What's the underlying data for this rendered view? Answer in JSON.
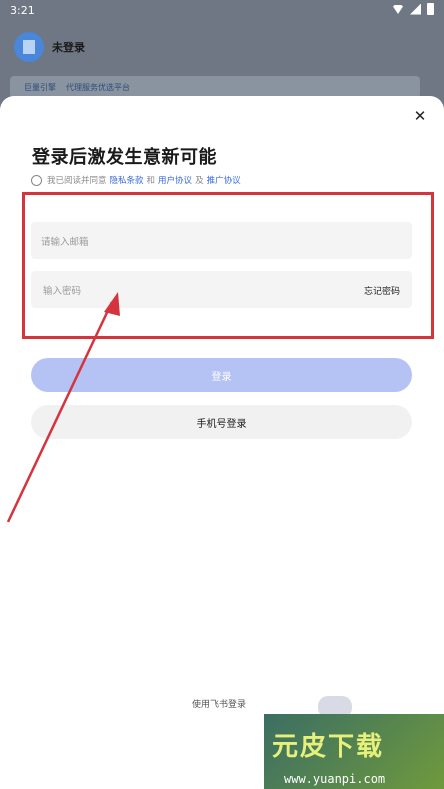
{
  "status_bar": {
    "time": "3:21"
  },
  "background": {
    "user_label": "未登录",
    "banner_brand_1": "巨量引擎",
    "banner_brand_2": "代理服务优选平台"
  },
  "sheet": {
    "close_glyph": "✕",
    "title": "登录后激发生意新可能",
    "agreement": {
      "prefix": "我已阅读并同意",
      "privacy": "隐私条款",
      "and1": "和",
      "user": "用户协议",
      "and2": "及",
      "promo": "推广协议"
    },
    "email_placeholder": "请输入邮箱",
    "password_placeholder": "输入密码",
    "forgot_password": "忘记密码",
    "login_button": "登录",
    "phone_login_button": "手机号登录",
    "feishu_login": "使用飞书登录"
  },
  "watermark": {
    "title": "元皮下载",
    "url": "www.yuanpi.com"
  },
  "colors": {
    "accent": "#3a6ae0",
    "annotation": "#d6343d",
    "login_disabled": "#b4c3f3"
  }
}
